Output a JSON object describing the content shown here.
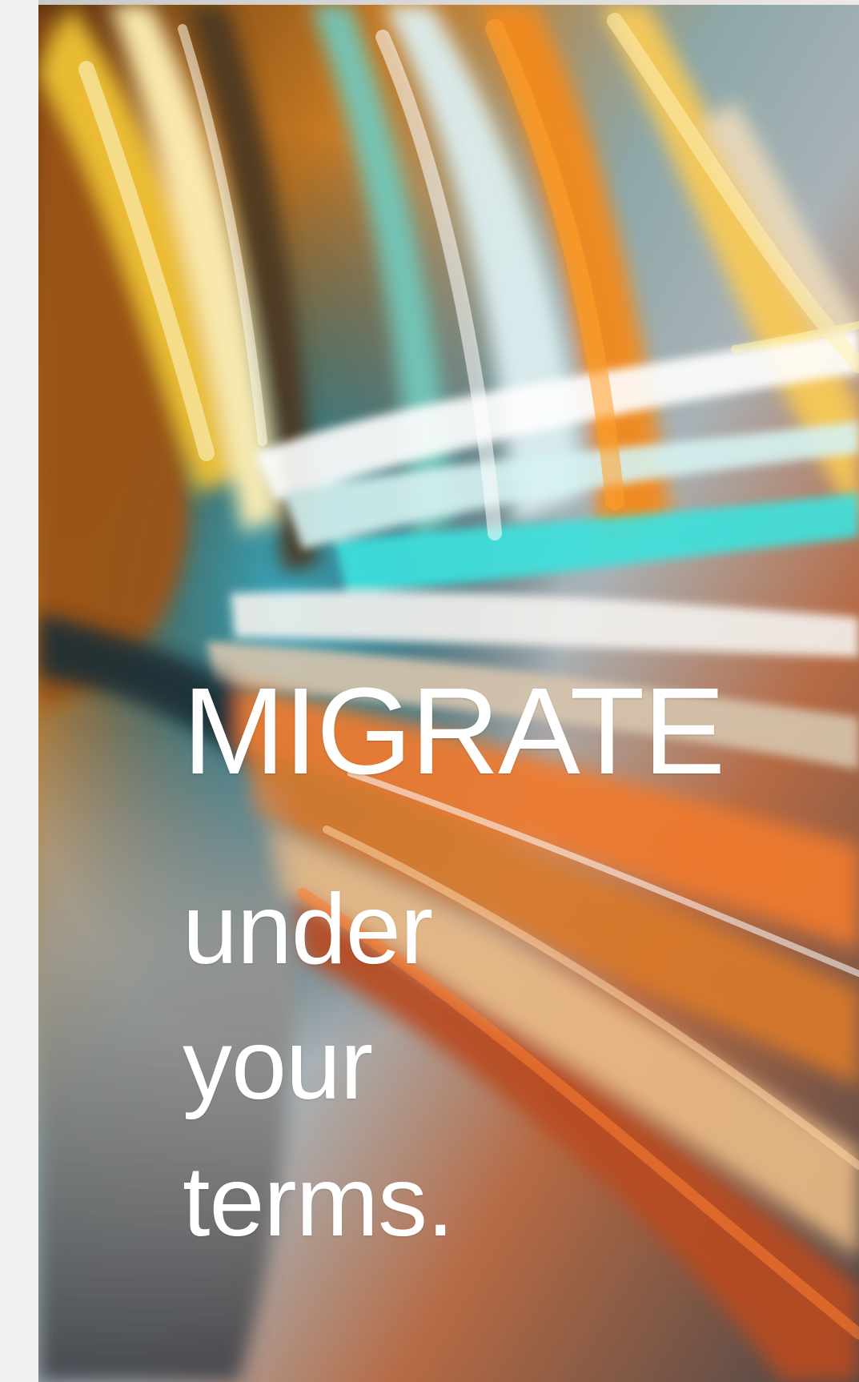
{
  "hero": {
    "headline": "MIGRATE",
    "subline": [
      "under",
      "your",
      "terms."
    ]
  },
  "colors": {
    "text": "#ffffff",
    "page_background": "#f0f0f0"
  }
}
